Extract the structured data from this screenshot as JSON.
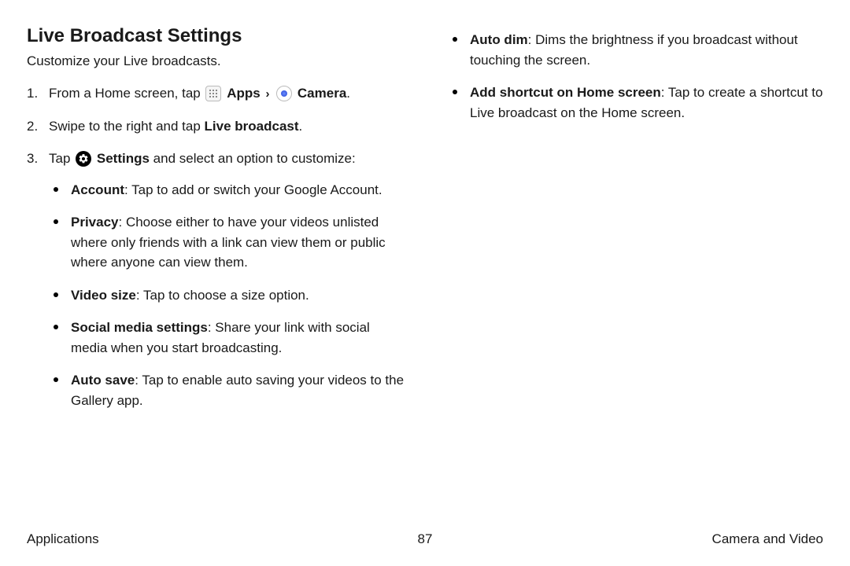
{
  "title": "Live Broadcast Settings",
  "intro": "Customize your Live broadcasts.",
  "step1_a": "From a Home screen, tap ",
  "step1_apps": "Apps",
  "step1_camera": "Camera",
  "step1_end": ".",
  "step2_a": "Swipe to the right and tap ",
  "step2_b": "Live broadcast",
  "step2_end": ".",
  "step3_a": "Tap ",
  "step3_settings": "Settings",
  "step3_b": " and select an option to customize:",
  "bullets_left": [
    {
      "label": "Account",
      "text": ": Tap to add or switch your Google Account."
    },
    {
      "label": "Privacy",
      "text": ": Choose either to have your videos unlisted where only friends with a link can view them or public where anyone can view them."
    },
    {
      "label": "Video size",
      "text": ": Tap to choose a size option."
    },
    {
      "label": "Social media settings",
      "text": ": Share your link with social media when you start broadcasting."
    },
    {
      "label": "Auto save",
      "text": ": Tap to enable auto saving your videos to the Gallery app."
    }
  ],
  "bullets_right": [
    {
      "label": "Auto dim",
      "text": ": Dims the brightness if you broadcast without touching the screen."
    },
    {
      "label": "Add shortcut on Home screen",
      "text": ": Tap to create a shortcut to Live broadcast on the Home screen."
    }
  ],
  "footer": {
    "left": "Applications",
    "center": "87",
    "right": "Camera and Video"
  }
}
